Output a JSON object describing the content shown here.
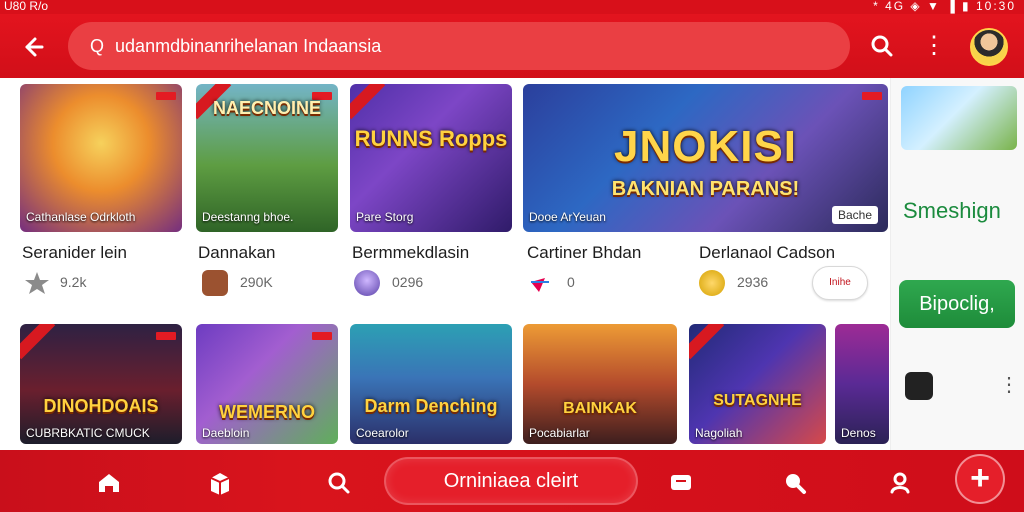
{
  "status_bar": {
    "left_text": "U80 R/o",
    "right_text": "* 4G ◈ ▼ ▐ ▮ 10:30"
  },
  "header": {
    "search_prefix": "Q",
    "search_text": "udanmdbinanrihelanan Indaansia",
    "icons": [
      "back-arrow-icon",
      "search-icon",
      "more-vert-icon",
      "avatar"
    ]
  },
  "games": [
    {
      "thumb_title": "",
      "thumb_caption": "Cathanlase Odrkloth",
      "title": "Seranider lein",
      "meta_icon": "star-icon",
      "meta_text": "9.2k"
    },
    {
      "thumb_title": "NAECNOINE",
      "thumb_caption": "Deestanng bhoe.",
      "title": "Dannakan",
      "meta_icon": "gift-icon",
      "meta_text": "290K"
    },
    {
      "thumb_title": "RUNNS Ropps",
      "thumb_caption": "Pare Storg",
      "title": "Bermmekdlasin",
      "meta_icon": "avatar-icon",
      "meta_text": "0296"
    },
    {
      "thumb_title": "JNOKISI",
      "thumb_caption": "Dooe ArYeuan",
      "title": "Cartiner Bhdan",
      "meta_icon": "heart-arrow-icon",
      "meta_text": "0"
    },
    {
      "thumb_title": "BAKNIAN PARANS!",
      "thumb_caption": "Bache",
      "title": "Derlanaol Cadson",
      "meta_icon": "coin-icon",
      "meta_text": "2936"
    }
  ],
  "second_row": [
    {
      "thumb_title": "DINOHDOAIS",
      "thumb_caption": "CUBRBKATIC CMUCK"
    },
    {
      "thumb_title": "WEMERNO",
      "thumb_caption": "Daebloin"
    },
    {
      "thumb_title": "Darm Denching",
      "thumb_caption": "Coearolor"
    },
    {
      "thumb_title": "BAINKAK",
      "thumb_caption": "Pocabiarlar"
    },
    {
      "thumb_title": "SUTAGNHE",
      "thumb_caption": "Nagoliah"
    },
    {
      "thumb_title": "",
      "thumb_caption": "Denos"
    }
  ],
  "right_panel": {
    "title": "Smeshign",
    "button_label": "Bipoclig,"
  },
  "install_chip_text": "Inihe",
  "bottom_nav": {
    "center_label": "Orniniaea cleirt"
  },
  "colors": {
    "primary": "#d8101a",
    "accent_green": "#1e8c3a",
    "text": "#1d1d1d",
    "muted": "#666666"
  }
}
